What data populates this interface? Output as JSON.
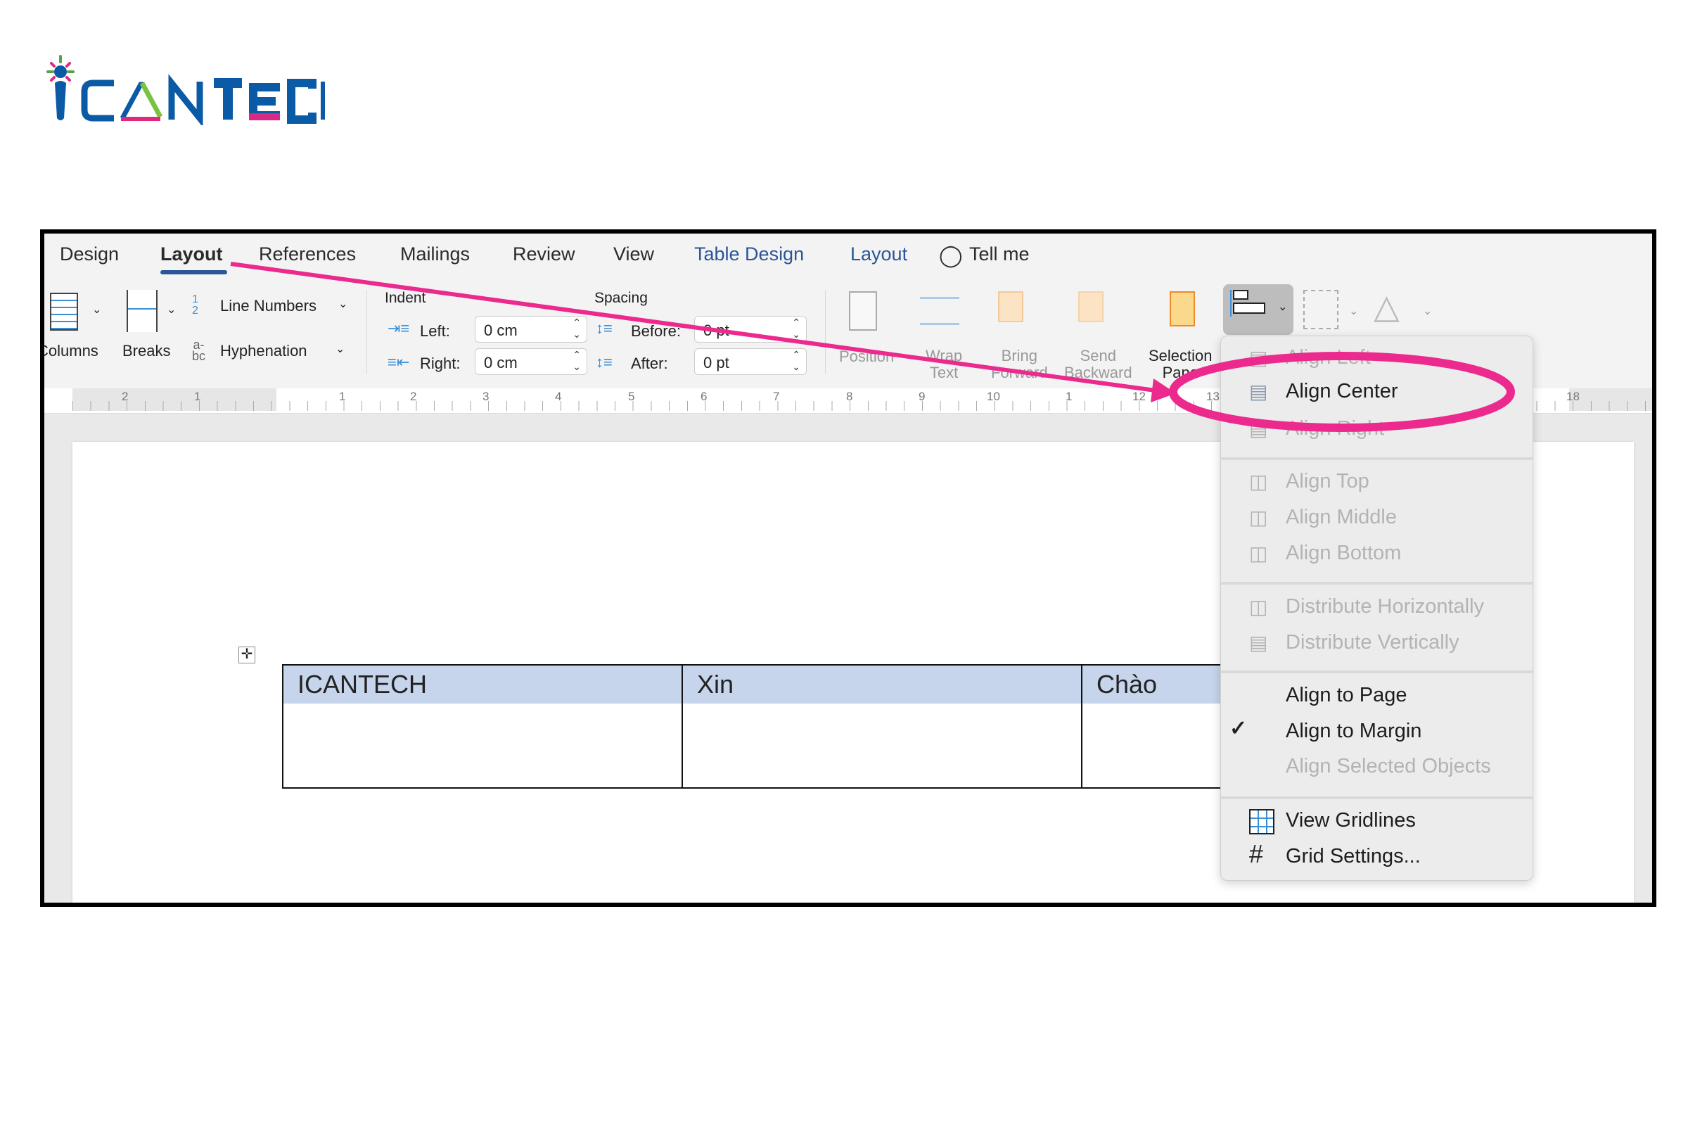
{
  "logo": {
    "text": "ICANTECH",
    "colors": {
      "blue": "#0a5aa5",
      "pink": "#e0287f",
      "green": "#7cc242"
    }
  },
  "ribbon_tabs": [
    {
      "label": "Design",
      "active": false
    },
    {
      "label": "Layout",
      "active": true
    },
    {
      "label": "References",
      "active": false
    },
    {
      "label": "Mailings",
      "active": false
    },
    {
      "label": "Review",
      "active": false
    },
    {
      "label": "View",
      "active": false
    },
    {
      "label": "Table Design",
      "contextual": true
    },
    {
      "label": "Layout",
      "contextual": true
    },
    {
      "label": "Tell me",
      "icon": "lightbulb-icon"
    }
  ],
  "page_setup": {
    "columns": "Columns",
    "breaks": "Breaks",
    "line_numbers": "Line Numbers",
    "hyphenation": "Hyphenation"
  },
  "indent": {
    "title": "Indent",
    "left_label": "Left:",
    "left_value": "0 cm",
    "right_label": "Right:",
    "right_value": "0 cm"
  },
  "spacing": {
    "title": "Spacing",
    "before_label": "Before:",
    "before_value": "0 pt",
    "after_label": "After:",
    "after_value": "0 pt"
  },
  "arrange": {
    "position": "Position",
    "wrap_text": [
      "Wrap",
      "Text"
    ],
    "bring_forward": [
      "Bring",
      "Forward"
    ],
    "send_backward": [
      "Send",
      "Backward"
    ],
    "selection_pane": [
      "Selection",
      "Pane"
    ]
  },
  "ruler_ticks": [
    "2",
    "1",
    "1",
    "2",
    "3",
    "4",
    "5",
    "6",
    "7",
    "8",
    "9",
    "10",
    "1",
    "12",
    "13",
    "18"
  ],
  "table": {
    "rows": [
      [
        "ICANTECH",
        "Xin",
        "Chào"
      ],
      [
        "",
        "",
        ""
      ]
    ],
    "header_highlight": "#c6d5ec"
  },
  "align_menu": {
    "groups": [
      [
        {
          "label": "Align Left",
          "enabled": false,
          "icon": "align-left-icon"
        },
        {
          "label": "Align Center",
          "enabled": true,
          "icon": "align-center-icon",
          "highlighted": true
        },
        {
          "label": "Align Right",
          "enabled": false,
          "icon": "align-right-icon"
        }
      ],
      [
        {
          "label": "Align Top",
          "enabled": false,
          "icon": "align-top-icon"
        },
        {
          "label": "Align Middle",
          "enabled": false,
          "icon": "align-middle-icon"
        },
        {
          "label": "Align Bottom",
          "enabled": false,
          "icon": "align-bottom-icon"
        }
      ],
      [
        {
          "label": "Distribute Horizontally",
          "enabled": false,
          "icon": "distribute-horizontal-icon"
        },
        {
          "label": "Distribute Vertically",
          "enabled": false,
          "icon": "distribute-vertical-icon"
        }
      ],
      [
        {
          "label": "Align to Page",
          "enabled": true
        },
        {
          "label": "Align to Margin",
          "enabled": true,
          "checked": true
        },
        {
          "label": "Align Selected Objects",
          "enabled": false
        }
      ],
      [
        {
          "label": "View Gridlines",
          "enabled": true,
          "icon": "gridlines-icon"
        },
        {
          "label": "Grid Settings...",
          "enabled": true,
          "icon": "grid-settings-icon"
        }
      ]
    ]
  },
  "annotation_color": "#ec2a8e"
}
